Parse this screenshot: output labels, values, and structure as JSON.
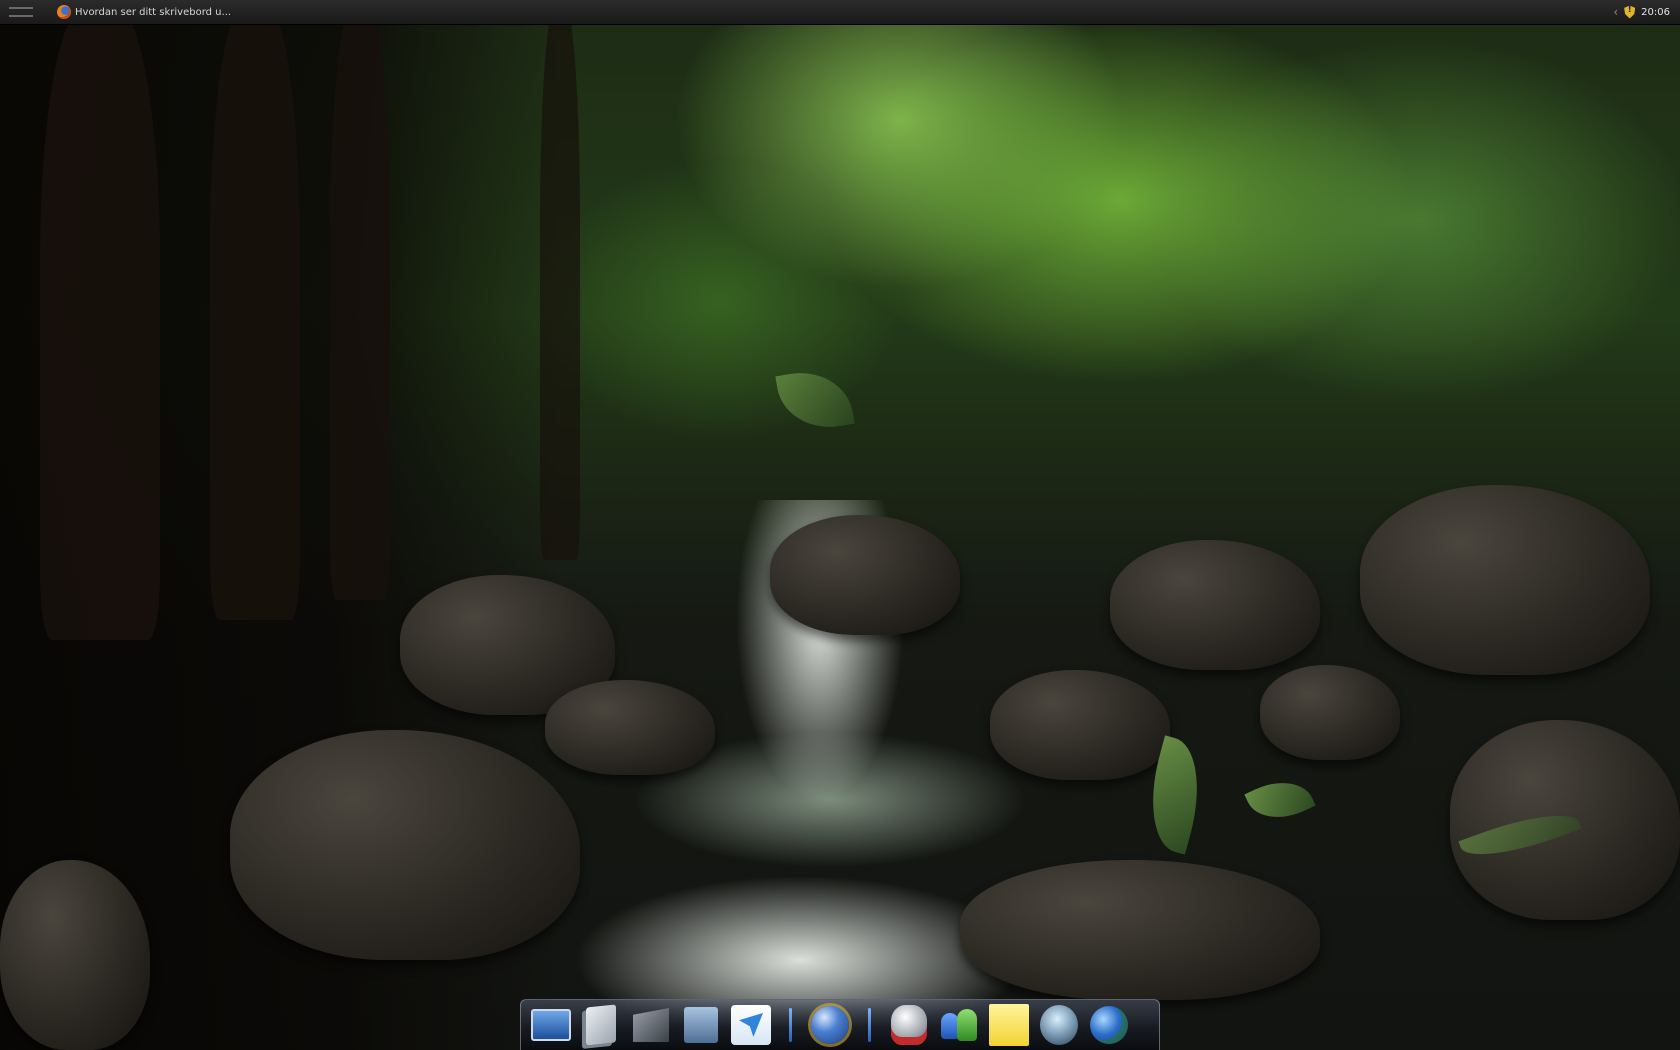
{
  "top_panel": {
    "task_title": "Hvordan ser ditt skrivebord u...",
    "clock": "20:06"
  },
  "dock": {
    "items": [
      {
        "icon": "desktop-icon"
      },
      {
        "icon": "documents-icon"
      },
      {
        "icon": "files-icon"
      },
      {
        "icon": "notes-icon"
      },
      {
        "icon": "mail-icon"
      },
      {
        "icon": "browser-globe-icon"
      },
      {
        "icon": "robot-icon"
      },
      {
        "icon": "contacts-icon"
      },
      {
        "icon": "sticky-notes-icon"
      },
      {
        "icon": "media-icon"
      },
      {
        "icon": "earth-icon"
      }
    ]
  },
  "colors": {
    "panel": "#1f1f1f",
    "dock_separator": "#4f8fe0",
    "shield": "#e1b52a"
  }
}
